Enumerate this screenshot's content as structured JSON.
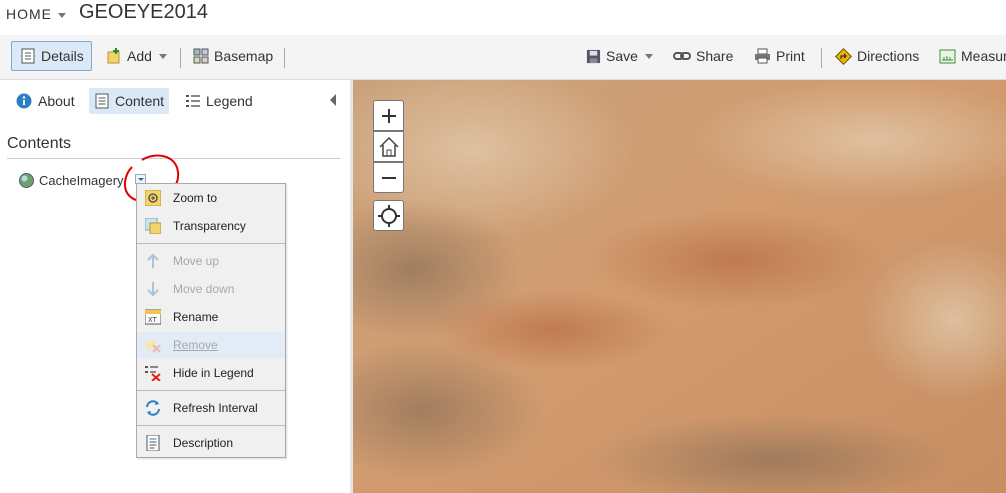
{
  "header": {
    "home_label": "HOME",
    "title": "GEOEYE2014"
  },
  "toolbar": {
    "details": "Details",
    "add": "Add",
    "basemap": "Basemap",
    "save": "Save",
    "share": "Share",
    "print": "Print",
    "directions": "Directions",
    "measure": "Measur"
  },
  "panel": {
    "tabs": {
      "about": "About",
      "content": "Content",
      "legend": "Legend"
    },
    "heading": "Contents",
    "layer": "CacheImagery"
  },
  "menu": {
    "items": [
      {
        "label": "Zoom to",
        "icon": "zoom-to-icon",
        "enabled": true
      },
      {
        "label": "Transparency",
        "icon": "transparency-icon",
        "enabled": true
      },
      {
        "label": "Move up",
        "icon": "arrow-up-icon",
        "enabled": false
      },
      {
        "label": "Move down",
        "icon": "arrow-down-icon",
        "enabled": false
      },
      {
        "label": "Rename",
        "icon": "rename-icon",
        "enabled": true
      },
      {
        "label": "Remove",
        "icon": "remove-icon",
        "enabled": false
      },
      {
        "label": "Hide in Legend",
        "icon": "hide-legend-icon",
        "enabled": true
      },
      {
        "label": "Refresh Interval",
        "icon": "refresh-icon",
        "enabled": true
      },
      {
        "label": "Description",
        "icon": "description-icon",
        "enabled": true
      }
    ]
  },
  "colors": {
    "accent": "#2d7ec2",
    "selected_bg": "#dbe9f6",
    "annotation": "#e00000"
  }
}
